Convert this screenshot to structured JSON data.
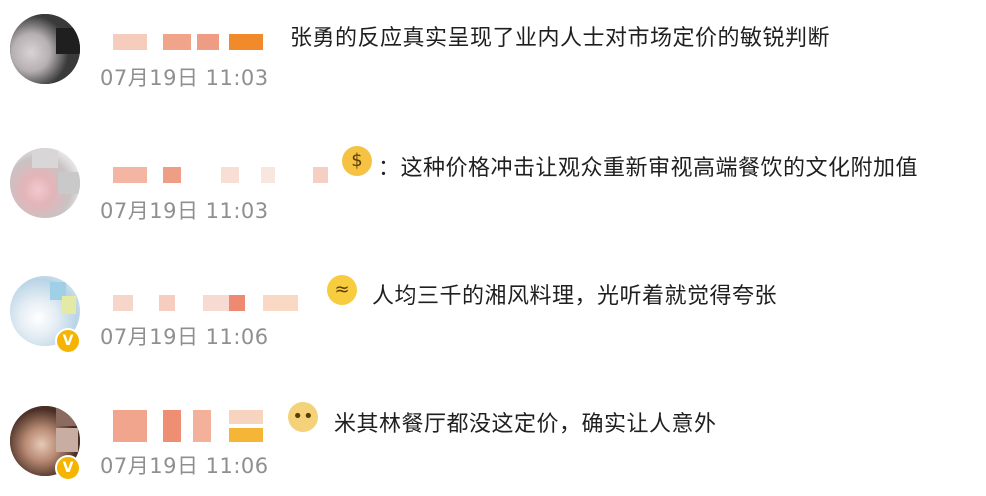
{
  "comments": [
    {
      "text": "张勇的反应真实呈现了业内人士对市场定价的敏锐判断",
      "time": "07月19日 11:03",
      "emoji": null,
      "verified": false
    },
    {
      "text": "：这种价格冲击让观众重新审视高端餐饮的文化附加值",
      "time": "07月19日 11:03",
      "emoji": "money-face-emoji",
      "verified": false
    },
    {
      "text": "人均三千的湘风料理，光听着就觉得夸张",
      "time": "07月19日 11:06",
      "emoji": "crying-face-emoji",
      "verified": true
    },
    {
      "text": "米其林餐厅都没这定价，确实让人意外",
      "time": "07月19日 11:06",
      "emoji": "doge-emoji",
      "verified": true
    }
  ],
  "colors": {
    "text": "#1f1f1f",
    "time": "#8f8f8f",
    "nickname_blur_light": "#f6d4c6",
    "nickname_blur_mid": "#f0a58a",
    "nickname_blur_orange": "#f08a2a",
    "verified_badge": "#f5b400"
  }
}
